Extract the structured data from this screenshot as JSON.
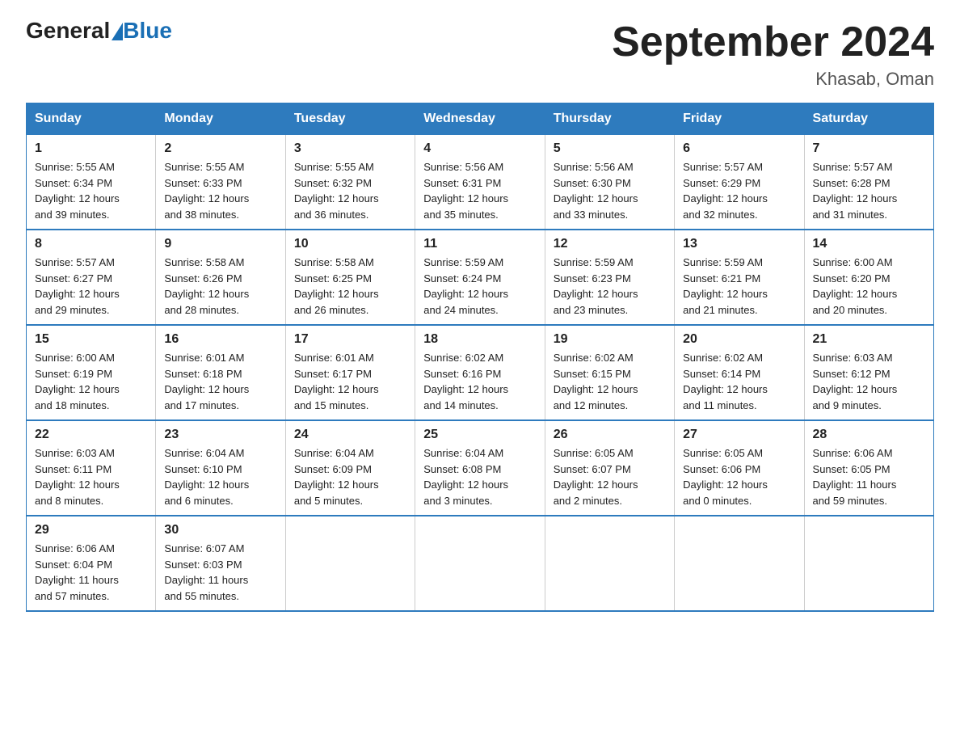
{
  "logo": {
    "general": "General",
    "blue": "Blue"
  },
  "header": {
    "title": "September 2024",
    "subtitle": "Khasab, Oman"
  },
  "days_of_week": [
    "Sunday",
    "Monday",
    "Tuesday",
    "Wednesday",
    "Thursday",
    "Friday",
    "Saturday"
  ],
  "weeks": [
    [
      {
        "day": "1",
        "sunrise": "5:55 AM",
        "sunset": "6:34 PM",
        "daylight": "12 hours and 39 minutes."
      },
      {
        "day": "2",
        "sunrise": "5:55 AM",
        "sunset": "6:33 PM",
        "daylight": "12 hours and 38 minutes."
      },
      {
        "day": "3",
        "sunrise": "5:55 AM",
        "sunset": "6:32 PM",
        "daylight": "12 hours and 36 minutes."
      },
      {
        "day": "4",
        "sunrise": "5:56 AM",
        "sunset": "6:31 PM",
        "daylight": "12 hours and 35 minutes."
      },
      {
        "day": "5",
        "sunrise": "5:56 AM",
        "sunset": "6:30 PM",
        "daylight": "12 hours and 33 minutes."
      },
      {
        "day": "6",
        "sunrise": "5:57 AM",
        "sunset": "6:29 PM",
        "daylight": "12 hours and 32 minutes."
      },
      {
        "day": "7",
        "sunrise": "5:57 AM",
        "sunset": "6:28 PM",
        "daylight": "12 hours and 31 minutes."
      }
    ],
    [
      {
        "day": "8",
        "sunrise": "5:57 AM",
        "sunset": "6:27 PM",
        "daylight": "12 hours and 29 minutes."
      },
      {
        "day": "9",
        "sunrise": "5:58 AM",
        "sunset": "6:26 PM",
        "daylight": "12 hours and 28 minutes."
      },
      {
        "day": "10",
        "sunrise": "5:58 AM",
        "sunset": "6:25 PM",
        "daylight": "12 hours and 26 minutes."
      },
      {
        "day": "11",
        "sunrise": "5:59 AM",
        "sunset": "6:24 PM",
        "daylight": "12 hours and 24 minutes."
      },
      {
        "day": "12",
        "sunrise": "5:59 AM",
        "sunset": "6:23 PM",
        "daylight": "12 hours and 23 minutes."
      },
      {
        "day": "13",
        "sunrise": "5:59 AM",
        "sunset": "6:21 PM",
        "daylight": "12 hours and 21 minutes."
      },
      {
        "day": "14",
        "sunrise": "6:00 AM",
        "sunset": "6:20 PM",
        "daylight": "12 hours and 20 minutes."
      }
    ],
    [
      {
        "day": "15",
        "sunrise": "6:00 AM",
        "sunset": "6:19 PM",
        "daylight": "12 hours and 18 minutes."
      },
      {
        "day": "16",
        "sunrise": "6:01 AM",
        "sunset": "6:18 PM",
        "daylight": "12 hours and 17 minutes."
      },
      {
        "day": "17",
        "sunrise": "6:01 AM",
        "sunset": "6:17 PM",
        "daylight": "12 hours and 15 minutes."
      },
      {
        "day": "18",
        "sunrise": "6:02 AM",
        "sunset": "6:16 PM",
        "daylight": "12 hours and 14 minutes."
      },
      {
        "day": "19",
        "sunrise": "6:02 AM",
        "sunset": "6:15 PM",
        "daylight": "12 hours and 12 minutes."
      },
      {
        "day": "20",
        "sunrise": "6:02 AM",
        "sunset": "6:14 PM",
        "daylight": "12 hours and 11 minutes."
      },
      {
        "day": "21",
        "sunrise": "6:03 AM",
        "sunset": "6:12 PM",
        "daylight": "12 hours and 9 minutes."
      }
    ],
    [
      {
        "day": "22",
        "sunrise": "6:03 AM",
        "sunset": "6:11 PM",
        "daylight": "12 hours and 8 minutes."
      },
      {
        "day": "23",
        "sunrise": "6:04 AM",
        "sunset": "6:10 PM",
        "daylight": "12 hours and 6 minutes."
      },
      {
        "day": "24",
        "sunrise": "6:04 AM",
        "sunset": "6:09 PM",
        "daylight": "12 hours and 5 minutes."
      },
      {
        "day": "25",
        "sunrise": "6:04 AM",
        "sunset": "6:08 PM",
        "daylight": "12 hours and 3 minutes."
      },
      {
        "day": "26",
        "sunrise": "6:05 AM",
        "sunset": "6:07 PM",
        "daylight": "12 hours and 2 minutes."
      },
      {
        "day": "27",
        "sunrise": "6:05 AM",
        "sunset": "6:06 PM",
        "daylight": "12 hours and 0 minutes."
      },
      {
        "day": "28",
        "sunrise": "6:06 AM",
        "sunset": "6:05 PM",
        "daylight": "11 hours and 59 minutes."
      }
    ],
    [
      {
        "day": "29",
        "sunrise": "6:06 AM",
        "sunset": "6:04 PM",
        "daylight": "11 hours and 57 minutes."
      },
      {
        "day": "30",
        "sunrise": "6:07 AM",
        "sunset": "6:03 PM",
        "daylight": "11 hours and 55 minutes."
      },
      null,
      null,
      null,
      null,
      null
    ]
  ],
  "labels": {
    "sunrise": "Sunrise:",
    "sunset": "Sunset:",
    "daylight": "Daylight:"
  }
}
